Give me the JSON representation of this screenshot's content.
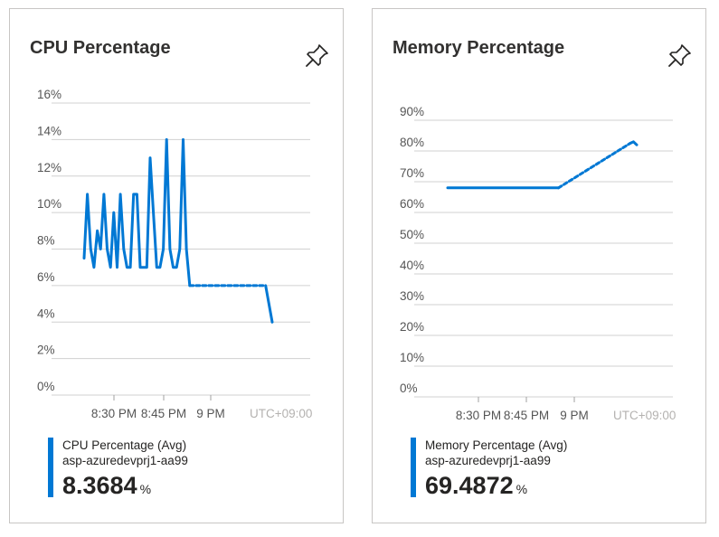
{
  "colors": {
    "accent": "#0078d4",
    "grid": "#d0d0d0",
    "text": "#252423"
  },
  "tiles": [
    {
      "title": "CPU Percentage",
      "pin_icon": "pin-icon",
      "legend": {
        "series": "CPU Percentage (Avg)",
        "resource": "asp-azuredevprj1-aa99",
        "value": "8.3684",
        "unit": "%"
      }
    },
    {
      "title": "Memory Percentage",
      "pin_icon": "pin-icon",
      "legend": {
        "series": "Memory Percentage (Avg)",
        "resource": "asp-azuredevprj1-aa99",
        "value": "69.4872",
        "unit": "%"
      }
    }
  ],
  "chart_data": [
    {
      "type": "line",
      "title": "CPU Percentage",
      "xlabel": "",
      "ylabel": "",
      "ylim": [
        0,
        16
      ],
      "y_ticks": [
        "0%",
        "2%",
        "4%",
        "6%",
        "8%",
        "10%",
        "12%",
        "14%",
        "16%"
      ],
      "x_ticks": [
        "8:30 PM",
        "8:45 PM",
        "9 PM"
      ],
      "timezone": "UTC+09:00",
      "grid": true,
      "series": [
        {
          "name": "CPU Percentage (Avg)",
          "segments": [
            {
              "style": "solid",
              "points": [
                [
                  0,
                  7.5
                ],
                [
                  1,
                  11
                ],
                [
                  2,
                  8
                ],
                [
                  3,
                  7
                ],
                [
                  4,
                  9
                ],
                [
                  5,
                  8
                ],
                [
                  6,
                  11
                ],
                [
                  7,
                  8
                ],
                [
                  8,
                  7
                ],
                [
                  9,
                  10
                ],
                [
                  10,
                  7
                ],
                [
                  11,
                  11
                ],
                [
                  12,
                  8
                ],
                [
                  13,
                  7
                ],
                [
                  14,
                  7
                ],
                [
                  15,
                  11
                ],
                [
                  16,
                  11
                ],
                [
                  17,
                  7
                ],
                [
                  18,
                  7
                ],
                [
                  19,
                  7
                ],
                [
                  20,
                  13
                ],
                [
                  21,
                  10
                ],
                [
                  22,
                  7
                ],
                [
                  23,
                  7
                ],
                [
                  24,
                  8
                ],
                [
                  25,
                  14
                ],
                [
                  26,
                  8
                ],
                [
                  27,
                  7
                ],
                [
                  28,
                  7
                ],
                [
                  29,
                  8
                ],
                [
                  30,
                  14
                ],
                [
                  31,
                  8
                ],
                [
                  32,
                  6
                ]
              ]
            },
            {
              "style": "dotted",
              "points": [
                [
                  32,
                  6
                ],
                [
                  55,
                  6
                ]
              ]
            },
            {
              "style": "solid",
              "points": [
                [
                  55,
                  6
                ],
                [
                  57,
                  4
                ]
              ]
            }
          ]
        }
      ]
    },
    {
      "type": "line",
      "title": "Memory Percentage",
      "xlabel": "",
      "ylabel": "",
      "ylim": [
        0,
        90
      ],
      "y_ticks": [
        "0%",
        "10%",
        "20%",
        "30%",
        "40%",
        "50%",
        "60%",
        "70%",
        "80%",
        "90%"
      ],
      "x_ticks": [
        "8:30 PM",
        "8:45 PM",
        "9 PM"
      ],
      "timezone": "UTC+09:00",
      "grid": true,
      "series": [
        {
          "name": "Memory Percentage (Avg)",
          "segments": [
            {
              "style": "solid",
              "points": [
                [
                  0,
                  68
                ],
                [
                  34,
                  68
                ]
              ]
            },
            {
              "style": "dotted",
              "points": [
                [
                  34,
                  68
                ],
                [
                  56,
                  82.5
                ]
              ]
            },
            {
              "style": "solid",
              "points": [
                [
                  56,
                  82.5
                ],
                [
                  57,
                  83
                ],
                [
                  58,
                  82
                ]
              ]
            }
          ]
        }
      ]
    }
  ]
}
